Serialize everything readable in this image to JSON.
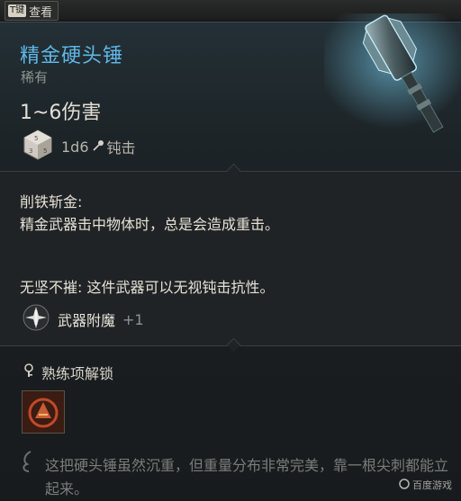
{
  "key_hint": {
    "key": "T键",
    "label": "查看"
  },
  "item": {
    "name": "精金硬头锤",
    "rarity": "稀有",
    "damage": "1~6伤害",
    "dice": "1d6",
    "damage_type": "钝击"
  },
  "passives": [
    {
      "title": "削铁斩金:",
      "desc": "精金武器击中物体时，总是会造成重击。"
    },
    {
      "text": "无坚不摧: 这件武器可以无视钝击抗性。"
    }
  ],
  "enchant": {
    "label": "武器附魔",
    "bonus": "+1"
  },
  "proficiency": {
    "label": "熟练项解锁"
  },
  "flavor": "这把硬头锤虽然沉重，但重量分布非常完美，靠一根尖刺都能立起来。",
  "watermark": "百度游戏",
  "colors": {
    "name": "#5fb7e6",
    "rarity": "#8f928e",
    "body_text": "#e6e1d7",
    "muted": "#7a7c79"
  },
  "icons": [
    "dice-icon",
    "mace-icon",
    "enchant-sigil-icon",
    "lock-key-icon",
    "proficiency-icon",
    "feather-icon"
  ]
}
